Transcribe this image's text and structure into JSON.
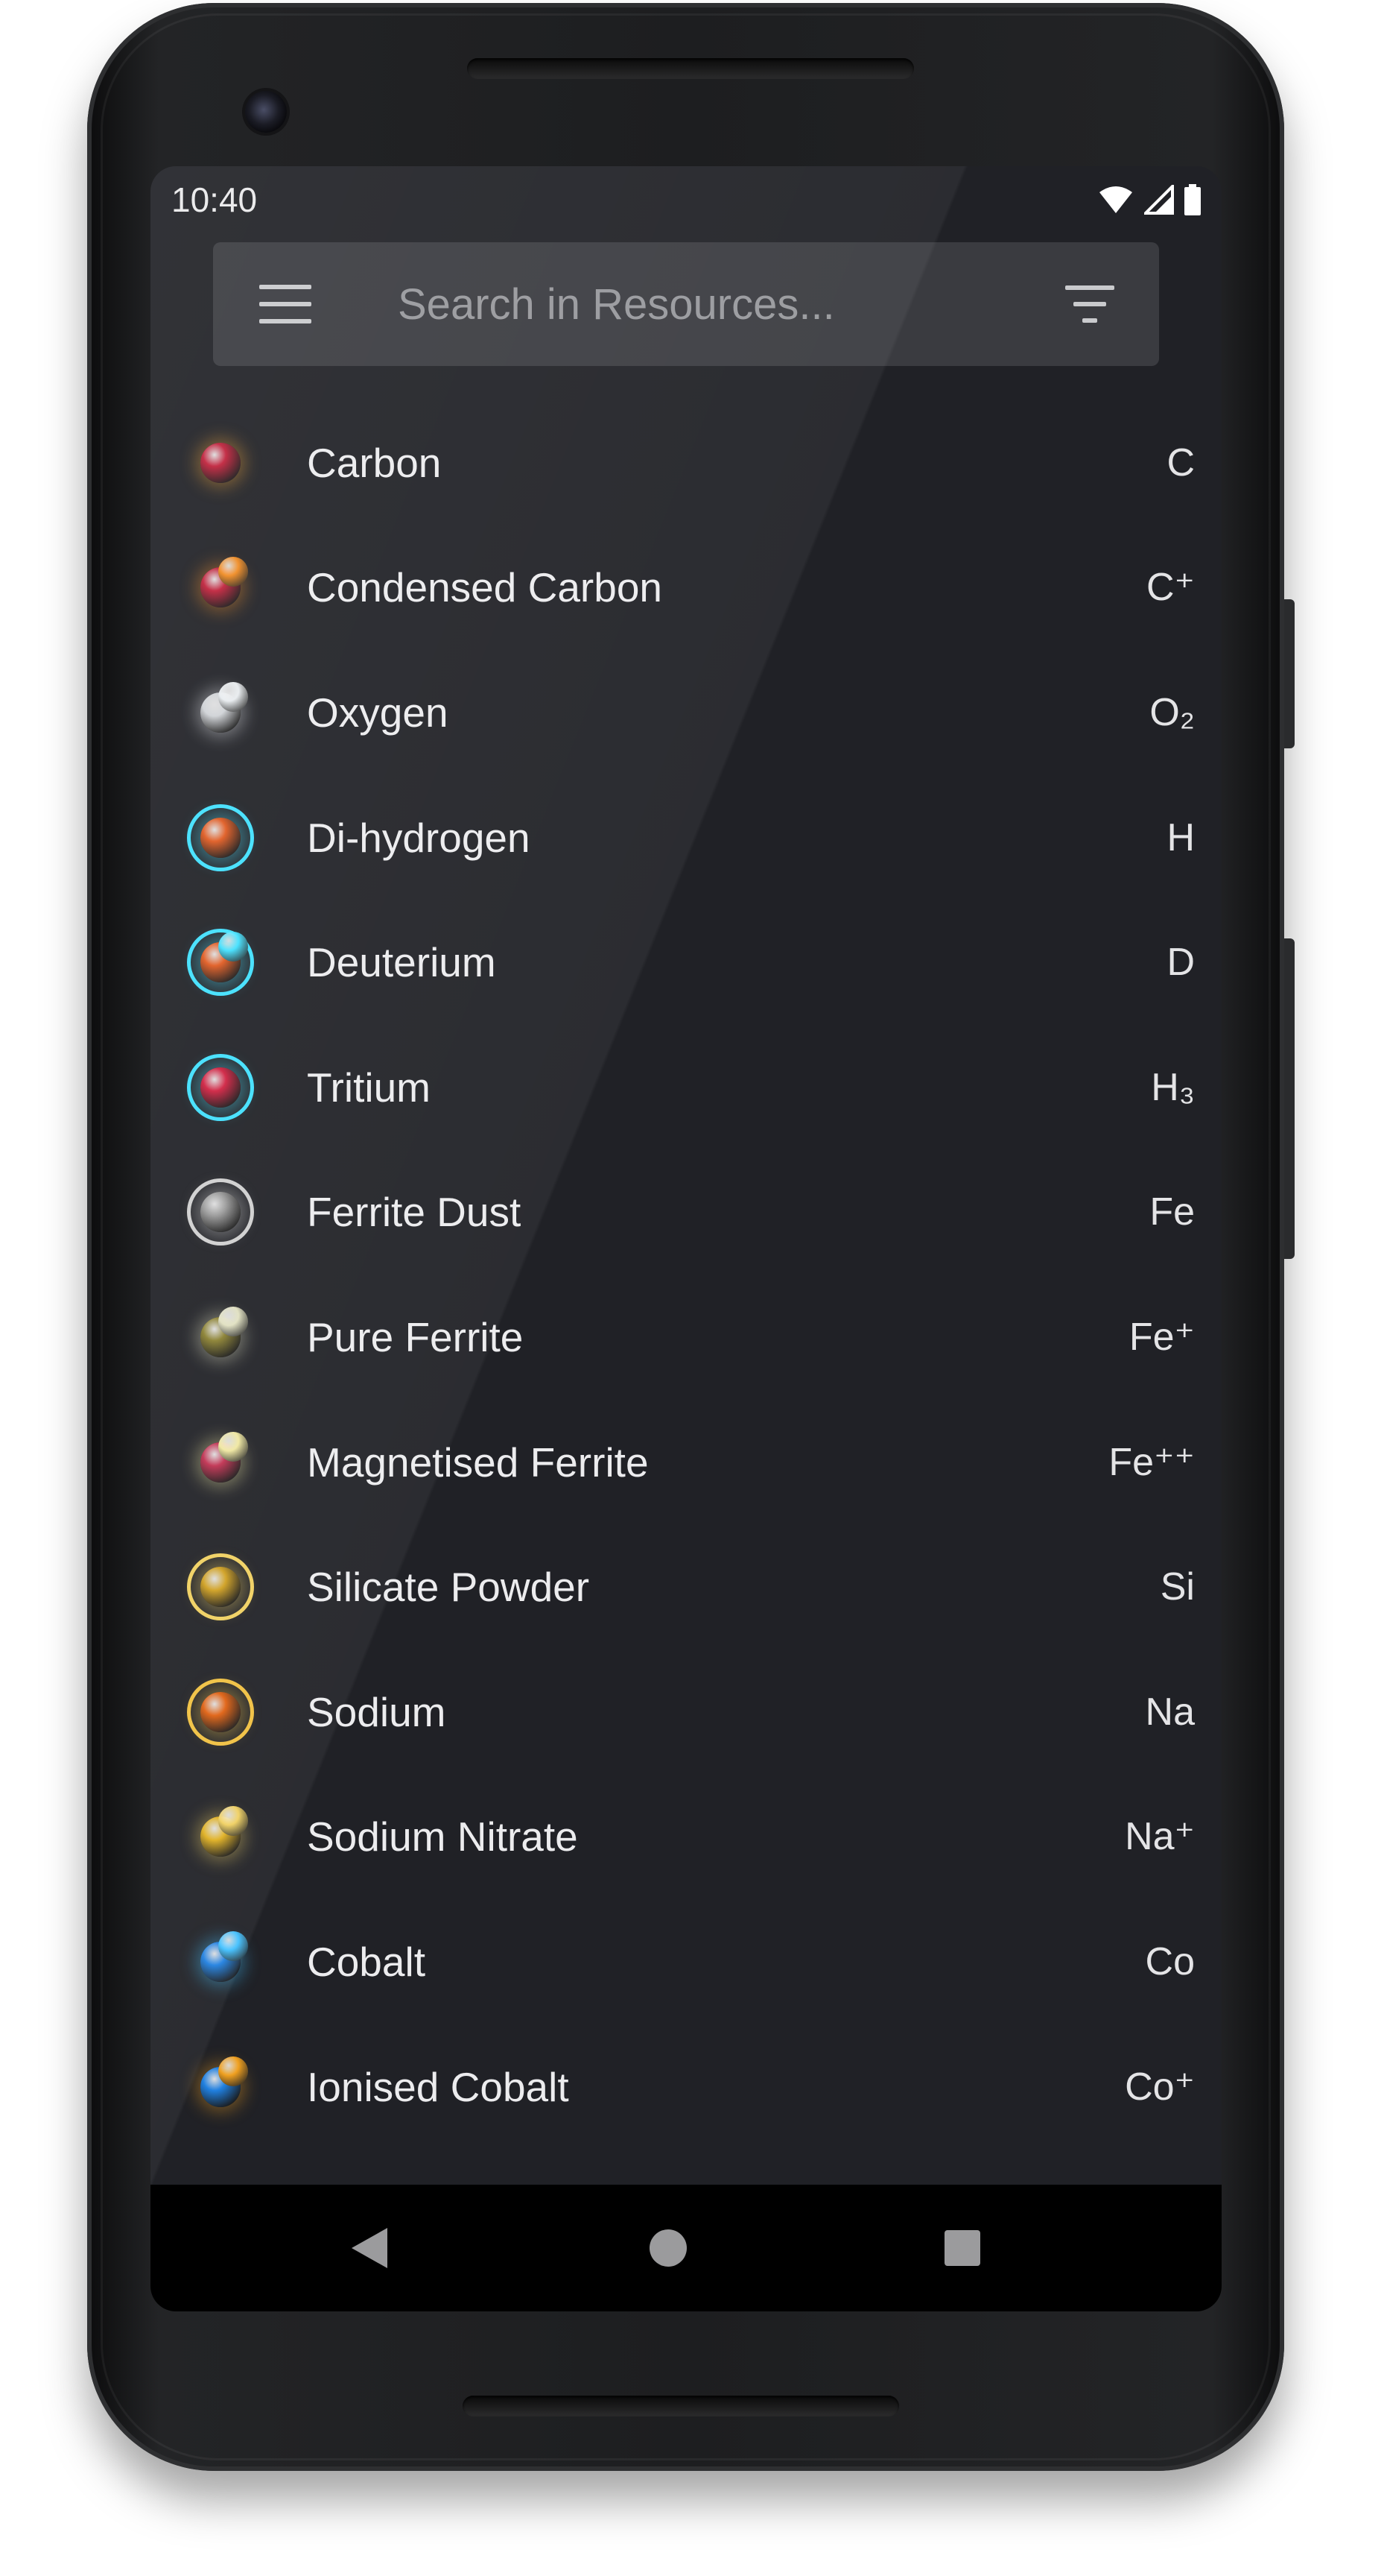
{
  "status_bar": {
    "time": "10:40"
  },
  "search": {
    "placeholder": "Search in Resources..."
  },
  "resources": [
    {
      "name": "Carbon",
      "symbol": "C",
      "icon": "carbon-icon",
      "color": "#c0203a",
      "glow": "#f0a030"
    },
    {
      "name": "Condensed Carbon",
      "symbol": "C⁺",
      "icon": "condensed-carbon-icon",
      "color": "#c0203a",
      "glow": "#f08a20"
    },
    {
      "name": "Oxygen",
      "symbol": "O₂",
      "icon": "oxygen-icon",
      "color": "#cfd2d6",
      "glow": "#e8ecef"
    },
    {
      "name": "Di-hydrogen",
      "symbol": "H",
      "icon": "di-hydrogen-icon",
      "color": "#e05a20",
      "glow": "#40e0ff"
    },
    {
      "name": "Deuterium",
      "symbol": "D",
      "icon": "deuterium-icon",
      "color": "#e05a20",
      "glow": "#40e0ff"
    },
    {
      "name": "Tritium",
      "symbol": "H₃",
      "icon": "tritium-icon",
      "color": "#d02040",
      "glow": "#40e0ff"
    },
    {
      "name": "Ferrite Dust",
      "symbol": "Fe",
      "icon": "ferrite-dust-icon",
      "color": "#9a9a9a",
      "glow": "#cfcfcf"
    },
    {
      "name": "Pure Ferrite",
      "symbol": "Fe⁺",
      "icon": "pure-ferrite-icon",
      "color": "#8a8030",
      "glow": "#e0e0c0"
    },
    {
      "name": "Magnetised Ferrite",
      "symbol": "Fe⁺⁺",
      "icon": "magnetised-ferrite-icon",
      "color": "#c03050",
      "glow": "#f0e8a0"
    },
    {
      "name": "Silicate Powder",
      "symbol": "Si",
      "icon": "silicate-powder-icon",
      "color": "#d0a020",
      "glow": "#f0d060"
    },
    {
      "name": "Sodium",
      "symbol": "Na",
      "icon": "sodium-icon",
      "color": "#e06010",
      "glow": "#f0c040"
    },
    {
      "name": "Sodium Nitrate",
      "symbol": "Na⁺",
      "icon": "sodium-nitrate-icon",
      "color": "#e0b020",
      "glow": "#f0d060"
    },
    {
      "name": "Cobalt",
      "symbol": "Co",
      "icon": "cobalt-icon",
      "color": "#2080e0",
      "glow": "#40c0ff"
    },
    {
      "name": "Ionised Cobalt",
      "symbol": "Co⁺",
      "icon": "ionised-cobalt-icon",
      "color": "#2080e0",
      "glow": "#f0a020"
    }
  ]
}
